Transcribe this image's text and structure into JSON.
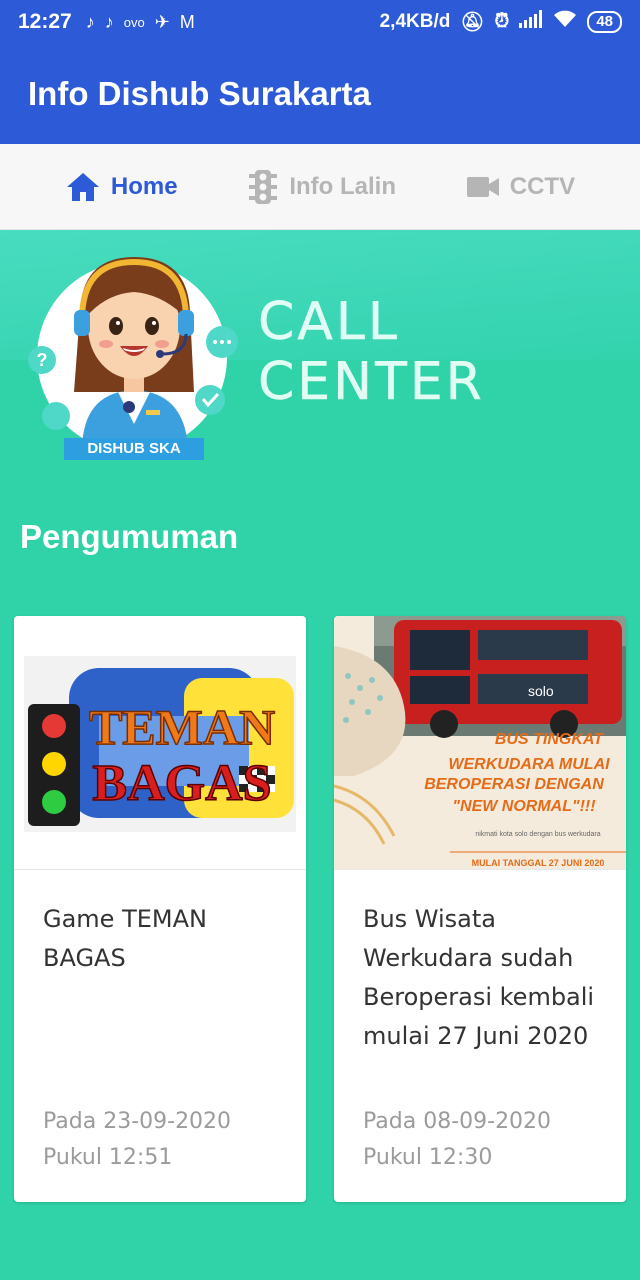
{
  "status_bar": {
    "time": "12:27",
    "left_icons": [
      "tiktok-icon",
      "tiktok-icon",
      "ovo-icon",
      "bird-icon",
      "gmail-icon"
    ],
    "ovo_label": "ovo",
    "net_speed": "2,4KB/d",
    "battery": "48"
  },
  "app_bar": {
    "title": "Info Dishub Surakarta"
  },
  "tabs": [
    {
      "label": "Home",
      "icon": "home-icon",
      "active": true
    },
    {
      "label": "Info Lalin",
      "icon": "traffic-light-icon",
      "active": false
    },
    {
      "label": "CCTV",
      "icon": "video-camera-icon",
      "active": false
    }
  ],
  "hero": {
    "call_center_text": "CALL CENTER",
    "badge_text": "DISHUB SKA"
  },
  "section": {
    "title": "Pengumuman"
  },
  "cards": [
    {
      "title": "Game TEMAN BAGAS",
      "image_text_line1": "TEMAN",
      "image_text_line2": "BAGAS",
      "date": "Pada 23-09-2020",
      "time": "Pukul 12:51"
    },
    {
      "title": "Bus Wisata Werkudara sudah Beroperasi kembali mulai 27 Juni 2020",
      "image_bus_brand": "solo",
      "image_headline_1": "BUS TINGKAT",
      "image_headline_2": "WERKUDARA MULAI",
      "image_headline_3": "BEROPERASI DENGAN",
      "image_headline_4": "\"NEW NORMAL\"!!!",
      "image_subtext": "nikmati kota solo dengan bus werkudara",
      "image_footer": "MULAI TANGGAL 27 JUNI 2020",
      "date": "Pada 08-09-2020",
      "time": "Pukul 12:30"
    }
  ],
  "colors": {
    "primary": "#2d5ad6",
    "background": "#2fd3a7",
    "tab_inactive": "#b5b5b5"
  }
}
